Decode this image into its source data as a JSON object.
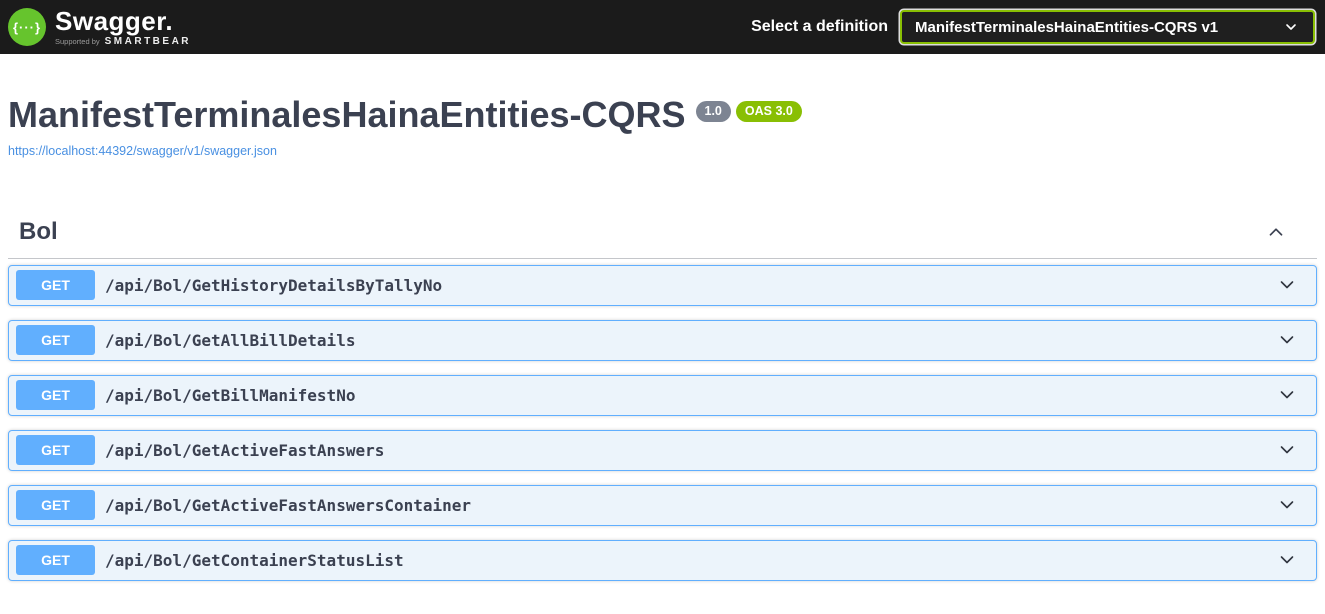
{
  "topbar": {
    "brand": {
      "name": "Swagger.",
      "icon_glyph": "{···}",
      "supported_by": "Supported by",
      "smartbear": "SMARTBEAR"
    },
    "definition_label": "Select a definition",
    "definition_select": {
      "value": "ManifestTerminalesHainaEntities-CQRS v1"
    }
  },
  "info": {
    "title": "ManifestTerminalesHainaEntities-CQRS",
    "version_badge": "1.0",
    "oas_badge": "OAS 3.0",
    "spec_url": "https://localhost:44392/swagger/v1/swagger.json"
  },
  "tag_section": {
    "name": "Bol",
    "expanded": true
  },
  "operations": [
    {
      "method": "GET",
      "path": "/api/Bol/GetHistoryDetailsByTallyNo"
    },
    {
      "method": "GET",
      "path": "/api/Bol/GetAllBillDetails"
    },
    {
      "method": "GET",
      "path": "/api/Bol/GetBillManifestNo"
    },
    {
      "method": "GET",
      "path": "/api/Bol/GetActiveFastAnswers"
    },
    {
      "method": "GET",
      "path": "/api/Bol/GetActiveFastAnswersContainer"
    },
    {
      "method": "GET",
      "path": "/api/Bol/GetContainerStatusList"
    }
  ],
  "colors": {
    "topbar_background": "#1b1b1b",
    "logo_green": "#66c42d",
    "select_border_green": "#89bf04",
    "get_blue": "#61affe",
    "get_row_background": "#ecf4fb",
    "title_dark": "#3b4151",
    "link_blue": "#4990e2",
    "version_badge_gray": "#7d8492",
    "oas_badge_green": "#89bf04"
  }
}
